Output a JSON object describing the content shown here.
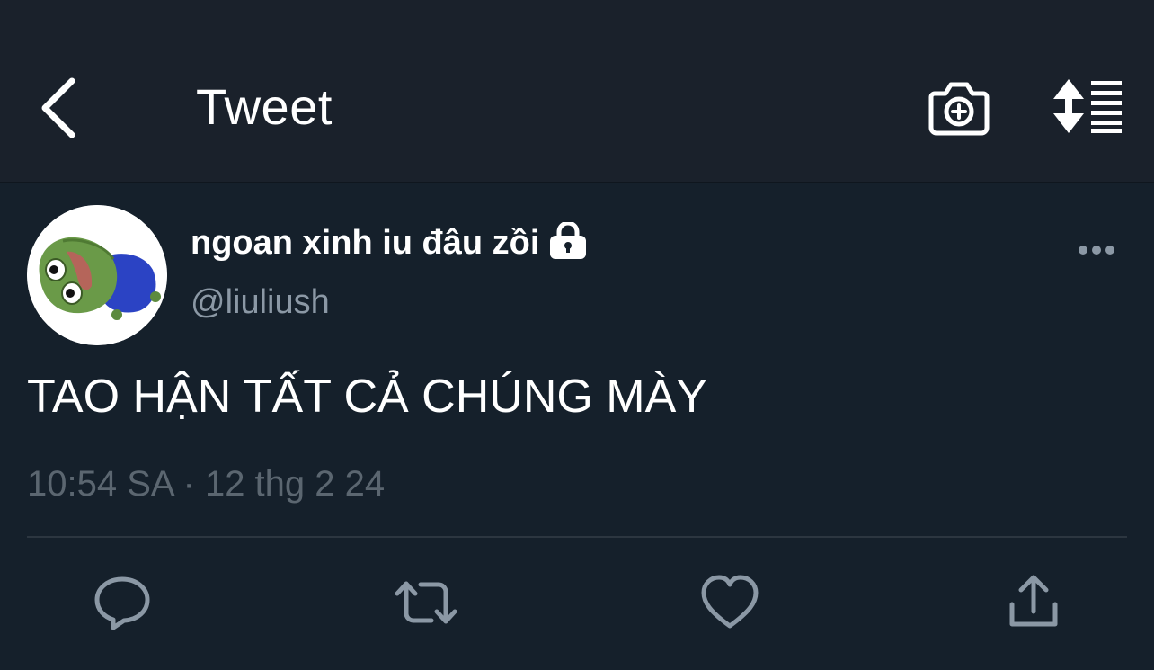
{
  "header": {
    "title": "Tweet",
    "back_icon": "chevron-left-icon",
    "camera_icon": "camera-add-icon",
    "sort_icon": "sort-list-icon"
  },
  "tweet": {
    "author": {
      "display_name": "ngoan xinh iu đâu zồi",
      "handle": "@liuliush",
      "protected_icon": "lock-icon"
    },
    "text": "TAO HẬN TẤT CẢ CHÚNG MÀY",
    "time": "10:54 SA",
    "separator": "·",
    "date": "12 thg 2 24"
  },
  "actions": {
    "reply_icon": "reply-icon",
    "retweet_icon": "retweet-icon",
    "like_icon": "heart-icon",
    "share_icon": "share-icon"
  },
  "colors": {
    "background": "#15202b",
    "header_background": "#1a212b",
    "primary_text": "#ffffff",
    "secondary_text": "#8b98a5",
    "muted_text": "#5b6670",
    "divider": "#2c3640"
  }
}
